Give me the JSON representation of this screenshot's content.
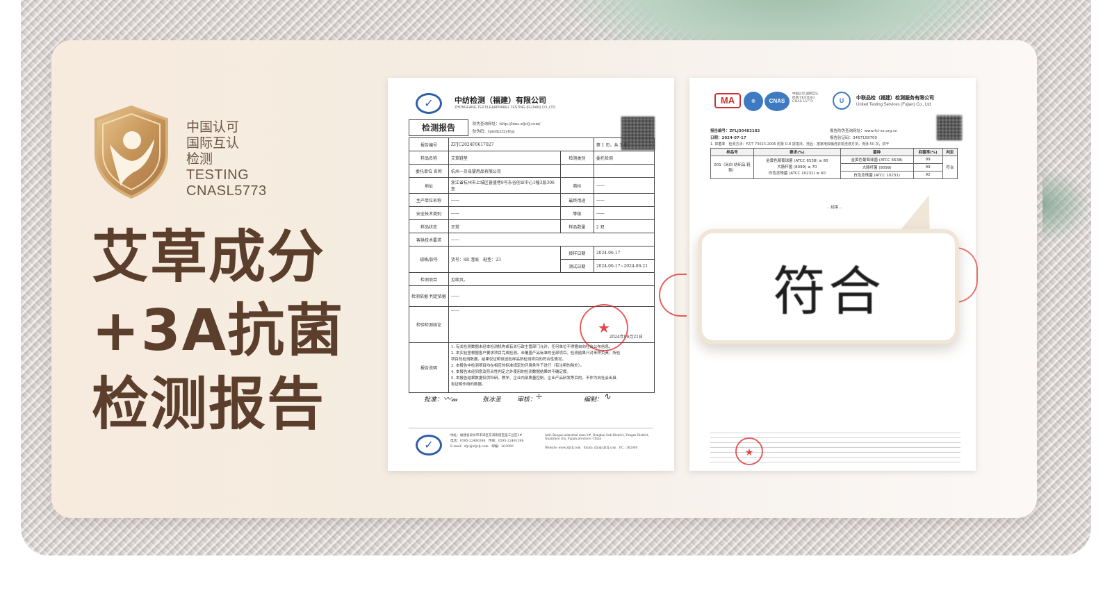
{
  "badge": {
    "line1": "中国认可",
    "line2": "国际互认",
    "line3": "检测",
    "line4": "TESTING",
    "line5": "CNASL5773"
  },
  "headline": {
    "line1": "艾草成分",
    "line2": "+3A抗菌",
    "line3": "检测报告"
  },
  "report_left": {
    "org_name": "中纺检测（福建）有限公司",
    "org_en": "ZHONGFANG TEXTILE&APPAREL TESTING (FUJIAN) CO.,LTD.",
    "title": "检测报告",
    "verify_url": "防伪查询网址：http://lims.zfjcfj.com/",
    "verify_code": "防伪码：tpmfk2f2y6yg",
    "report_no_label": "报告编号",
    "report_no": "ZFJC2024F0617027",
    "page": "第 1 页，共 3 页",
    "rows": [
      {
        "k1": "样品名称",
        "v1": "艾草鞋垫",
        "k2": "检测类别",
        "v2": "委托检测"
      },
      {
        "k1": "委托单位 名称",
        "v1": "杭州一贝母婴用品有限公司",
        "k2": "",
        "v2": ""
      },
      {
        "k1": "地址",
        "v1": "浙江省杭州市上城区普盛巷9号东谷创业中心1幢3层306室",
        "k2": "商标",
        "v2": "——"
      },
      {
        "k1": "生产单位名称",
        "v1": "——",
        "k2": "最终用途",
        "v2": "——"
      },
      {
        "k1": "安全技术类别",
        "v1": "——",
        "k2": "等级",
        "v2": "——"
      },
      {
        "k1": "样品状态",
        "v1": "正常",
        "k2": "样品数量",
        "v2": "2 双"
      },
      {
        "k1": "客供技术要求",
        "v1": "——",
        "k2": "",
        "v2": ""
      },
      {
        "k1": "规格/款号",
        "v1": "货号：8R 澄底　鞋垫：23",
        "k2": "接样日期",
        "v2": "2024-06-17"
      },
      {
        "k1": "",
        "v1": "",
        "k2": "测试日期",
        "v2": "2024-06-17~2024-06-21"
      },
      {
        "k1": "检测项目",
        "v1": "见续页。",
        "k2": "",
        "v2": ""
      },
      {
        "k1": "检测依据 判定依据",
        "v1": "——",
        "k2": "",
        "v2": ""
      },
      {
        "k1": "检验检测结论",
        "v1": "——",
        "k2": "",
        "v2": ""
      }
    ],
    "conclusion_date": "2024年06月21日",
    "notes_label": "报告说明",
    "notes": [
      "1. 有关检测数据未经本检测机构或有关行政主管部门允许，任何单位不得擅自向社会公布信息。",
      "2. 本实验室根据客户要求项目完成检测。未覆盖产品标准的全部项目。检测结果只对来样负责。所检",
      "   项目的检测数据。结果仅证明该送检样品所检测项目的符合性情况。",
      "3. 本报告中检测项目均在相应的标准规定的环境条件下进行（有注明的除外）。",
      "4. 本报告未经同意及符合性判定之外使用的检测数据结果的不确定度。",
      "5. 本报告结果数据仅供科研、教学、企业内部质量控制、企业产品研发等目的，不作为向社会出具",
      "   有证明作用的数据。"
    ],
    "approve_label": "批准：",
    "approver": "张冰圣",
    "review_label": "审核：",
    "edit_label": "编制：",
    "footer_address": "地址：福建省泉州市丰泽区东海街道宝盖工业区2#",
    "footer_phone": "电话：0595-22490398　传真：0595-22491398",
    "footer_email": "E-mail：zfjc@zfjcfj.com　邮编：362000",
    "footer_en": "Add: Baogai industrial zone 2#, Donghai Sub-District, Fengze District, Quanzhou city, Fujian province, China",
    "footer_web": "Website: www.zfjcfj.com　Email: zfjc@zfjcfj.com　P.C.: 362000"
  },
  "report_right": {
    "cert_ma": "MA",
    "cert_cnas": "CNAS",
    "cert_note": "中国认可 国际互认 检测 TESTING CNAS L5773",
    "org_name": "中联品检（福建）检测服务有限公司",
    "org_en": "United Testing Services (Fujian) Co., Ltd.",
    "report_no": "报告编号：ZFLJ30482182",
    "date": "日期：2024-07-17",
    "verify": "报告防伪查询网址：www.fcl-sz.org.cn",
    "verify_code": "报告验证码：3467158700",
    "method": "1.  抑菌率　检测方法：FZ/T 73023-2006 附录 D.8 振荡法，洗后：按家用双桶洗衣机洗涤方法，洗涤 50 次，烘干",
    "headers": [
      "样品号",
      "要求(%)",
      "菌种",
      "抑菌率(%)",
      "判定"
    ],
    "sample": "001（米白 纺织品 鞋垫）",
    "requirements": [
      "金黄色葡萄球菌 (ATCC 6538) ≥ 80",
      "大肠杆菌 (8099) ≥ 70",
      "白色念珠菌 (ATCC 10231) ≥ 60"
    ],
    "results": [
      {
        "strain": "金黄色葡萄球菌 (ATCC 6538)",
        "value": "99"
      },
      {
        "strain": "大肠杆菌 (8099)",
        "value": "99"
      },
      {
        "strain": "白色念珠菌 (ATCC 10231)",
        "value": "92"
      }
    ],
    "verdict": "符合",
    "end": "…结束…"
  },
  "callout": {
    "text": "符合"
  },
  "colors": {
    "headline": "#5b3f2c",
    "badge_gold": "#c99a5a",
    "card_bg": "#f6ebdd",
    "stamp_red": "#dc2828"
  }
}
